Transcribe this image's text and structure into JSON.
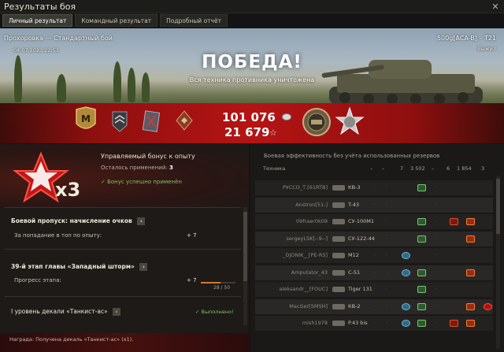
{
  "window": {
    "title": "Результаты боя",
    "close_glyph": "✕"
  },
  "tabs": [
    {
      "label": "Личный результат",
      "active": true
    },
    {
      "label": "Командный результат",
      "active": false
    },
    {
      "label": "Подробный отчёт",
      "active": false
    }
  ],
  "banner": {
    "map_title": "Прохоровка — Стандартный бой",
    "date": "04.07.2023 22:51",
    "player_name": "500g[ACA-B] – T21",
    "player_status": "Выжил",
    "result": "ПОБЕДА!",
    "result_sub": "Вся техника противника уничтожена",
    "credits": "101 076",
    "xp": "21 679",
    "xp_icon": "☆",
    "mastery_letter": "M",
    "colors": {
      "red_band": "#b51414",
      "gold": "#c9a04a"
    }
  },
  "bonus": {
    "multiplier": "x3",
    "title": "Управляемый бонус к опыту",
    "remaining_label": "Осталось применений:",
    "remaining_value": "3",
    "applied": "✓ Бонус успешно применён"
  },
  "battle_pass": {
    "header": "Боевой пропуск: начисление очков",
    "arrow_glyph": "›",
    "row_label": "За попадание в топ по опыту:",
    "row_value": "+ 7"
  },
  "chapter": {
    "header": "39-й этап главы «Западный шторм»",
    "arrow_glyph": "›",
    "row_label": "Прогресс этапа:",
    "row_value": "+ 7",
    "progress_current": 28,
    "progress_max": 50,
    "progress_text": "28 / 50"
  },
  "decal": {
    "header": "I уровень декали «Танкист-ас»",
    "arrow_glyph": "›",
    "done": "✓ Выполнено!"
  },
  "reward": {
    "text": "Награда:   Получена декаль «Танкист-ас» (x1)."
  },
  "efficiency": {
    "title": "Боевая эффективность без учёта использованных резервов",
    "col_vehicle": "Техника",
    "col_values": [
      "7",
      "3 502",
      "6",
      "1 854",
      "3"
    ],
    "dash": "–",
    "rows": [
      {
        "player": "РУССО_Т.[61RTB]",
        "tank": "КВ-3",
        "icons": [
          "track"
        ]
      },
      {
        "player": "Anstron[51-]",
        "tank": "T-43",
        "icons": []
      },
      {
        "player": "09fraer0k09",
        "tank": "СУ-100М1",
        "icons": [
          "track",
          "dmg",
          "crit"
        ]
      },
      {
        "player": "sergeyLSK[--9--]",
        "tank": "СУ-122-44",
        "icons": [
          "track",
          "crit"
        ]
      },
      {
        "player": "_DJONIK__[PE-RS]",
        "tank": "M12",
        "icons": [
          "spot"
        ]
      },
      {
        "player": "Amputator_43",
        "tank": "С-51",
        "icons": [
          "spot",
          "track",
          "crit"
        ]
      },
      {
        "player": "aleksandr__[FOUC]",
        "tank": "Tiger 131",
        "icons": [
          "track"
        ]
      },
      {
        "player": "MacGer[SMSH]",
        "tank": "КВ-2",
        "icons": [
          "spot",
          "track",
          "crit",
          "kill"
        ]
      },
      {
        "player": "mish1978",
        "tank": "P.43 bis",
        "icons": [
          "spot",
          "track",
          "dmg",
          "crit"
        ]
      }
    ]
  }
}
